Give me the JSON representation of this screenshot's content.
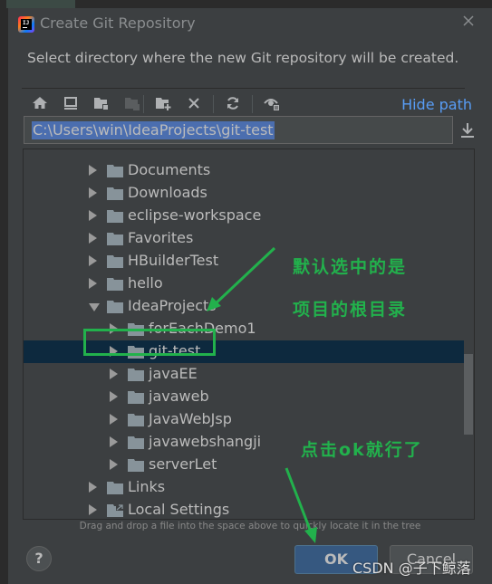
{
  "dialog": {
    "title": "Create Git Repository",
    "description": "Select directory where the new Git repository will be created.",
    "hide_path_label": "Hide path",
    "path_value": "C:\\Users\\win\\IdeaProjects\\git-test",
    "toolbar": {
      "icons": [
        "home-icon",
        "desktop-icon",
        "project-folder-icon",
        "module-folder-icon",
        "new-folder-icon",
        "delete-icon",
        "refresh-icon",
        "show-hidden-icon"
      ]
    },
    "tree": {
      "items": [
        {
          "label": "Documents",
          "level": 1,
          "expanded": false,
          "selected": false,
          "icon": "folder-icon"
        },
        {
          "label": "Downloads",
          "level": 1,
          "expanded": false,
          "selected": false,
          "icon": "folder-icon"
        },
        {
          "label": "eclipse-workspace",
          "level": 1,
          "expanded": false,
          "selected": false,
          "icon": "folder-icon"
        },
        {
          "label": "Favorites",
          "level": 1,
          "expanded": false,
          "selected": false,
          "icon": "folder-icon"
        },
        {
          "label": "HBuilderTest",
          "level": 1,
          "expanded": false,
          "selected": false,
          "icon": "folder-icon"
        },
        {
          "label": "hello",
          "level": 1,
          "expanded": false,
          "selected": false,
          "icon": "folder-icon"
        },
        {
          "label": "IdeaProjects",
          "level": 1,
          "expanded": true,
          "selected": false,
          "icon": "folder-icon"
        },
        {
          "label": "forEachDemo1",
          "level": 2,
          "expanded": false,
          "selected": false,
          "icon": "folder-icon"
        },
        {
          "label": "git-test",
          "level": 2,
          "expanded": false,
          "selected": true,
          "icon": "folder-icon"
        },
        {
          "label": "javaEE",
          "level": 2,
          "expanded": false,
          "selected": false,
          "icon": "folder-icon"
        },
        {
          "label": "javaweb",
          "level": 2,
          "expanded": false,
          "selected": false,
          "icon": "folder-icon"
        },
        {
          "label": "JavaWebJsp",
          "level": 2,
          "expanded": false,
          "selected": false,
          "icon": "folder-icon"
        },
        {
          "label": "javawebshangji",
          "level": 2,
          "expanded": false,
          "selected": false,
          "icon": "folder-icon"
        },
        {
          "label": "serverLet",
          "level": 2,
          "expanded": false,
          "selected": false,
          "icon": "folder-icon"
        },
        {
          "label": "Links",
          "level": 1,
          "expanded": false,
          "selected": false,
          "icon": "folder-icon"
        },
        {
          "label": "Local Settings",
          "level": 1,
          "expanded": false,
          "selected": false,
          "icon": "folder-link-icon"
        }
      ]
    },
    "hint": "Drag and drop a file into the space above to quickly locate it in the tree",
    "buttons": {
      "help": "?",
      "ok": "OK",
      "cancel": "Cancel"
    }
  },
  "annotations": {
    "note1_line1": "默认选中的是",
    "note1_line2": "项目的根目录",
    "note2": "点击ok就行了",
    "color": "#22b14c"
  },
  "watermark": "CSDN @子下鲸落",
  "colors": {
    "dialog_bg": "#3c3f41",
    "selection_bg": "#0d293e",
    "path_selection": "#4b6eaf",
    "link": "#589df6",
    "ok_button": "#365880"
  }
}
